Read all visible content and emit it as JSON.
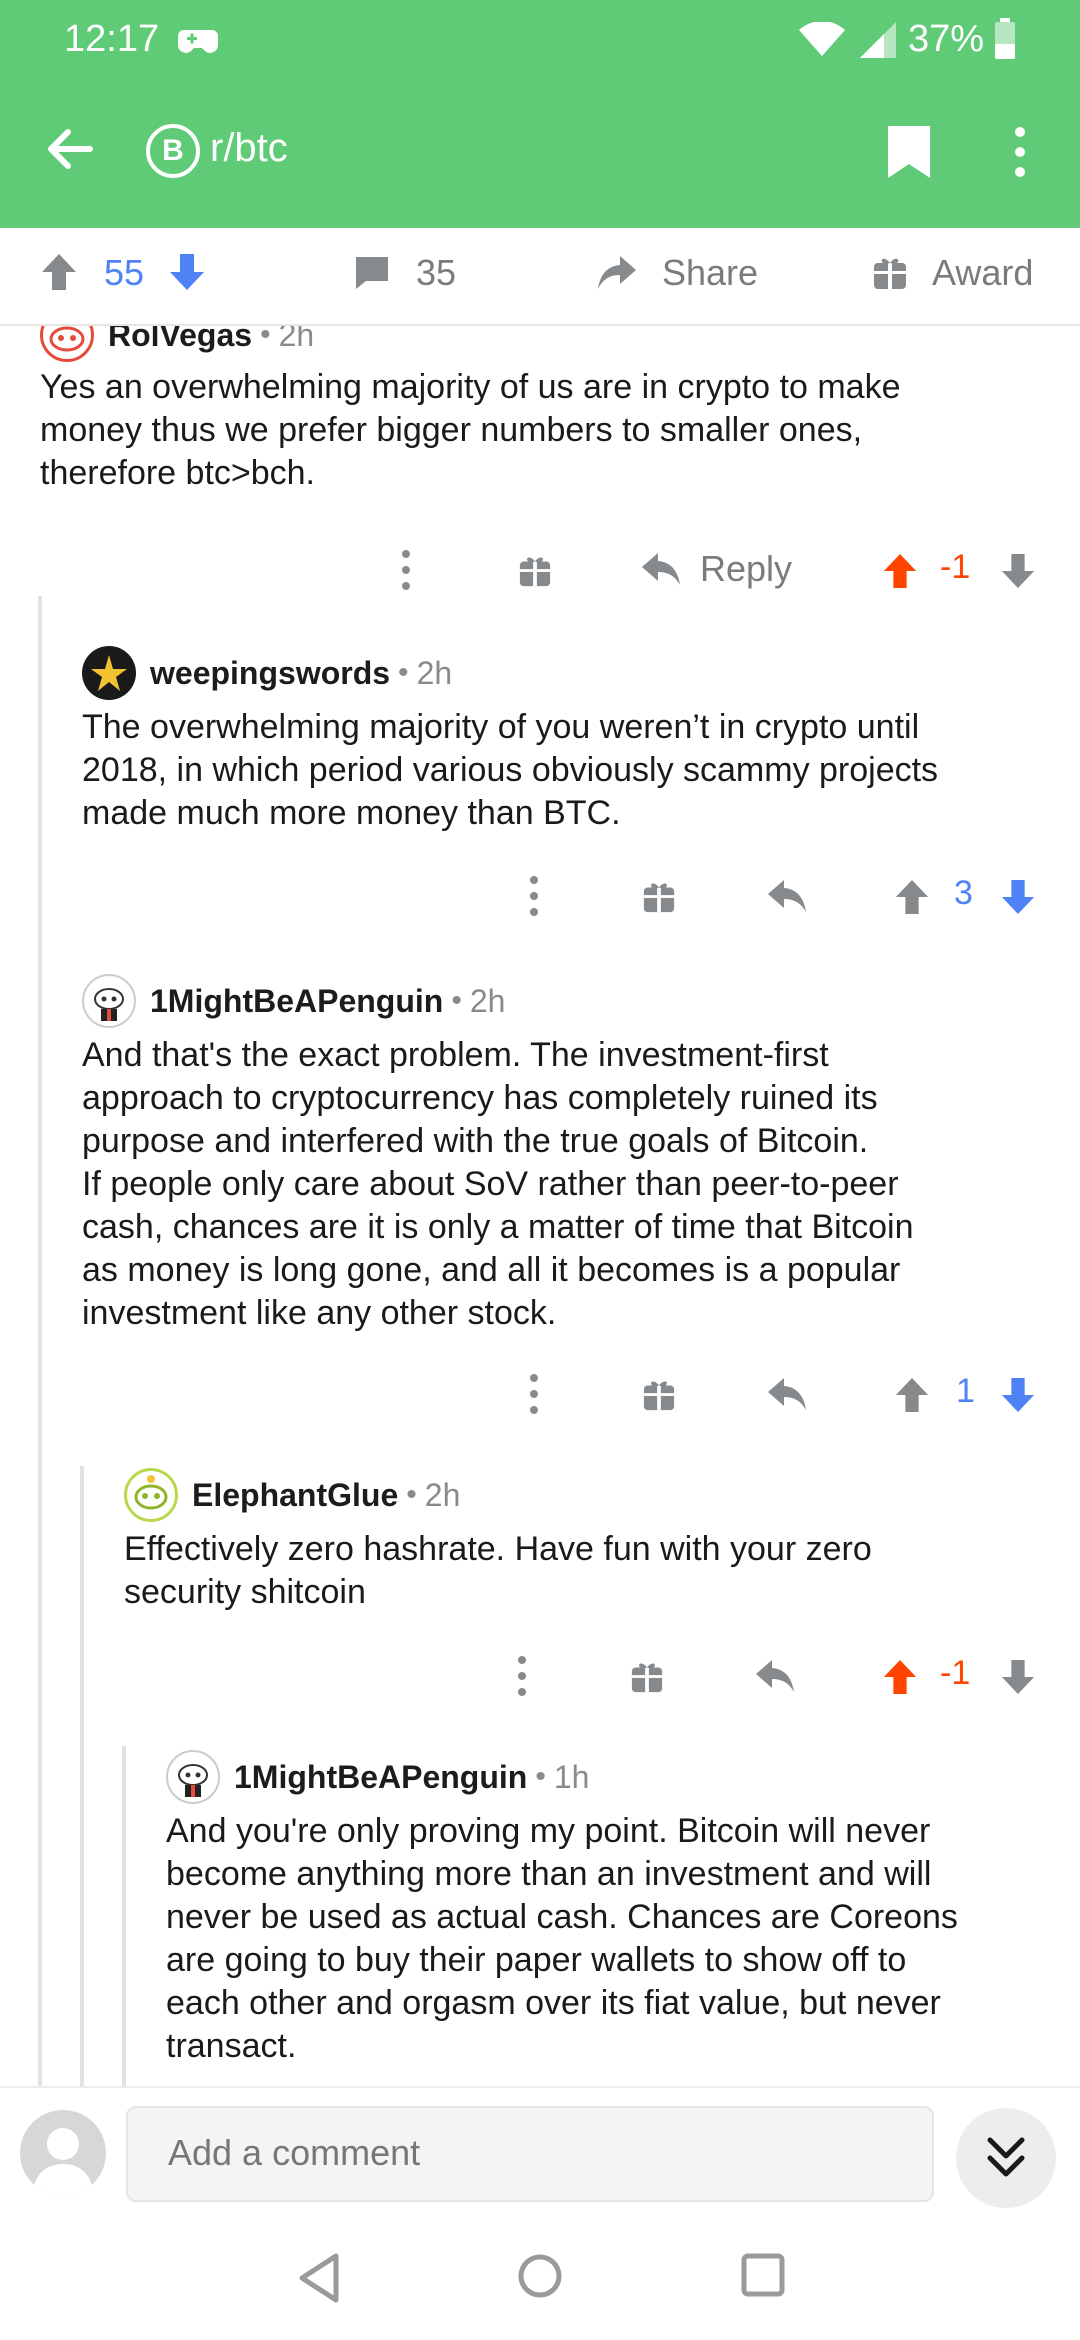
{
  "status_bar": {
    "time": "12:17",
    "battery": "37%"
  },
  "header": {
    "subreddit": "r/btc",
    "badge_letter": "B"
  },
  "post_bar": {
    "score": "55",
    "comments": "35",
    "share_label": "Share",
    "award_label": "Award"
  },
  "comments": [
    {
      "author": "RolVegas",
      "age": "2h",
      "body": "Yes an overwhelming majority of us are in crypto to make\nmoney thus we prefer bigger numbers to smaller ones,\ntherefore btc>bch.",
      "reply_label": "Reply",
      "score": "-1",
      "vote": "up"
    },
    {
      "author": "weepingswords",
      "age": "2h",
      "body": "The overwhelming majority of you weren’t in crypto until\n2018, in which period various obviously scammy projects\nmade much more money than BTC.",
      "score": "3",
      "vote": "down"
    },
    {
      "author": "1MightBeAPenguin",
      "age": "2h",
      "body": "And that's the exact problem. The investment-first\napproach to cryptocurrency has completely ruined its\npurpose and interfered with the true goals of Bitcoin.\nIf people only care about SoV rather than peer-to-peer\ncash, chances are it is only a matter of time that Bitcoin\nas money is long gone, and all it becomes is a popular\ninvestment like any other stock.",
      "score": "1",
      "vote": "down"
    },
    {
      "author": "ElephantGlue",
      "age": "2h",
      "body": "Effectively zero hashrate. Have fun with your zero\nsecurity shitcoin",
      "score": "-1",
      "vote": "up"
    },
    {
      "author": "1MightBeAPenguin",
      "age": "1h",
      "body": "And you're only proving my point. Bitcoin will never\nbecome anything more than an investment and will\nnever be used as actual cash. Chances are Coreons\nare going to buy their paper wallets to show off to\neach other and orgasm over its fiat value, but never\ntransact."
    }
  ],
  "composer": {
    "placeholder": "Add a comment"
  },
  "colors": {
    "header_green": "#5fcb77",
    "upvote": "#ff4500",
    "downvote": "#4e82f5",
    "gray_icon": "#878a8c"
  },
  "icons": {
    "back": "arrow-left-icon",
    "bookmark": "bookmark-icon",
    "more": "more-vertical-icon",
    "gift": "gift-icon",
    "reply": "reply-icon",
    "expand": "double-chevron-down-icon"
  }
}
